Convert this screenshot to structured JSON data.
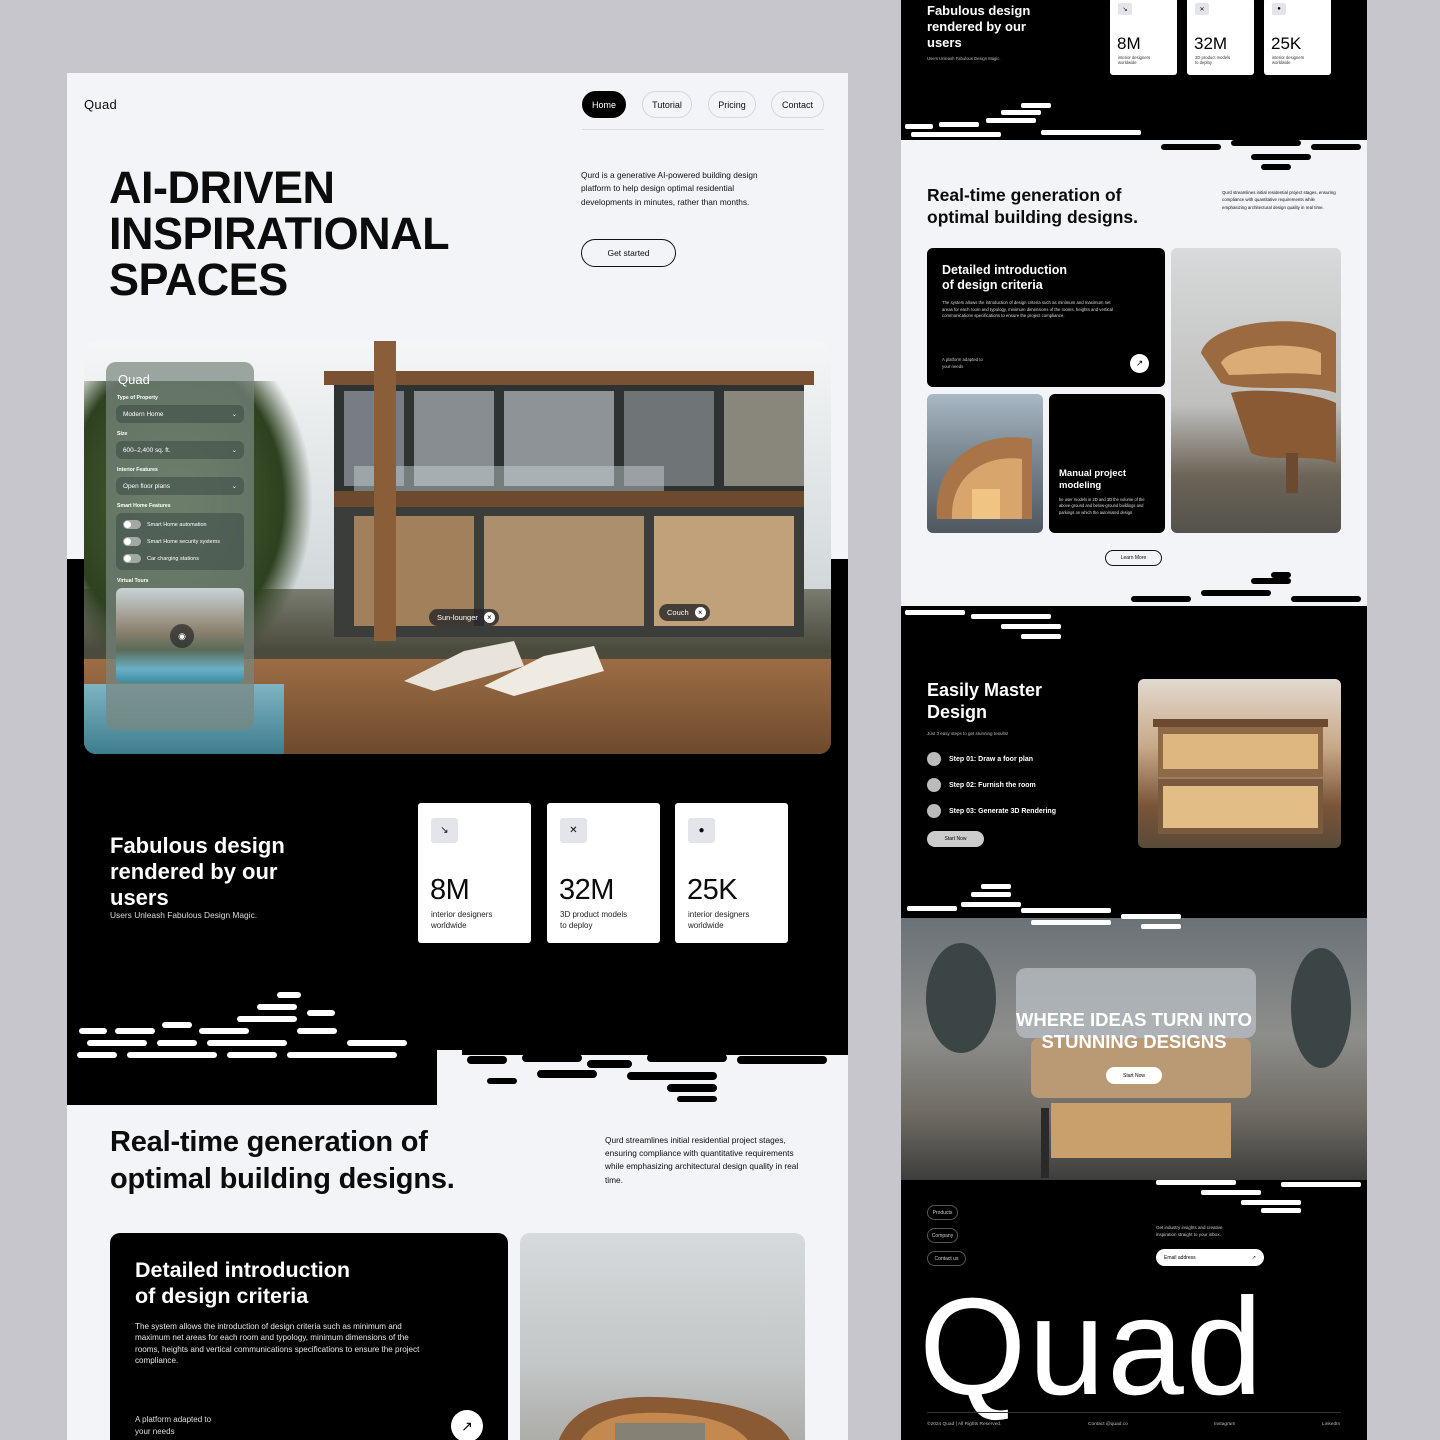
{
  "brand": "Quad",
  "nav": [
    {
      "label": "Home",
      "active": true
    },
    {
      "label": "Tutorial",
      "active": false
    },
    {
      "label": "Pricing",
      "active": false
    },
    {
      "label": "Contact",
      "active": false
    }
  ],
  "hero": {
    "line1": "AI-DRIVEN",
    "line2": "INSPIRATIONAL",
    "line3": "SPACES",
    "description": "Qurd is a generative AI-powered building design platform to help design optimal residential developments in minutes, rather than months.",
    "cta": "Get started"
  },
  "panel": {
    "logo": "Quad",
    "type_label": "Type of Property",
    "type_value": "Modern Home",
    "size_label": "Size",
    "size_value": "600–2,400 sq. ft.",
    "interior_label": "Interior Features",
    "interior_value": "Open floor plans",
    "smart_label": "Smart Home Features",
    "toggles": [
      "Smart Home automation",
      "Smart Home security systems",
      "Car charging stations"
    ],
    "tours_label": "Virtual Tours"
  },
  "tags": {
    "sun": "Sun-lounger",
    "couch": "Couch"
  },
  "stats": {
    "title_l1": "Fabulous design",
    "title_l2": "rendered by our",
    "title_l3": "users",
    "subtitle": "Users Unleash Fabulous Design Magic.",
    "items": [
      {
        "num": "8M",
        "cap1": "interior designers",
        "cap2": "worldwide",
        "icon": "↘"
      },
      {
        "num": "32M",
        "cap1": "3D product models",
        "cap2": "to deploy",
        "icon": "✕"
      },
      {
        "num": "25K",
        "cap1": "interior designers",
        "cap2": "worldwide",
        "icon": "●"
      }
    ]
  },
  "realtime": {
    "title_l1": "Real-time generation of",
    "title_l2": "optimal building designs.",
    "description": "Qurd  streamlines initial residential project stages, ensuring compliance with quantitative requirements while emphasizing architectural design quality in real time."
  },
  "criteria": {
    "title_l1": "Detailed introduction",
    "title_l2": "of design criteria",
    "body": "The system allows the introduction of design criteria such as minimum and maximum net areas for each room and typology, minimum dimensions of the rooms, heights and vertical communications specifications to ensure the project compliance.",
    "small_l1": "A platform adapted to",
    "small_l2": "your needs",
    "arrow": "↗"
  },
  "right": {
    "manual_l1": "Manual project",
    "manual_l2": "modeling",
    "manual_body": "he user models in 2D and 3D the volume of the above-ground and below-ground buildings and parkings on which the automated design",
    "learn_more": "Learn More",
    "master_l1": "Easily Master",
    "master_l2": "Design",
    "master_sub": "Just 3 easy steps to get stunning results!",
    "steps": [
      "Step 01:  Draw a foor plan",
      "Step 02:  Furnish the room",
      "Step 03:  Generate 3D Rendering"
    ],
    "start_now": "Start Now",
    "ideas_l1": "WHERE IDEAS TURN INTO",
    "ideas_l2": "STUNNING DESIGNS",
    "ideas_btn": "Start Now",
    "footer_links": [
      "Products",
      "Company",
      "Contact us"
    ],
    "newsletter_l1": "Get industry insights and creative",
    "newsletter_l2": "inspiration straight to your inbox.",
    "email_placeholder": "Email address",
    "big_logo": "Quad",
    "copyright": "©2024 Quad | All Rights Reserved.",
    "contact": "Contact @quad.co",
    "instagram": "Instagram",
    "linkedin": "LinkedIn"
  }
}
